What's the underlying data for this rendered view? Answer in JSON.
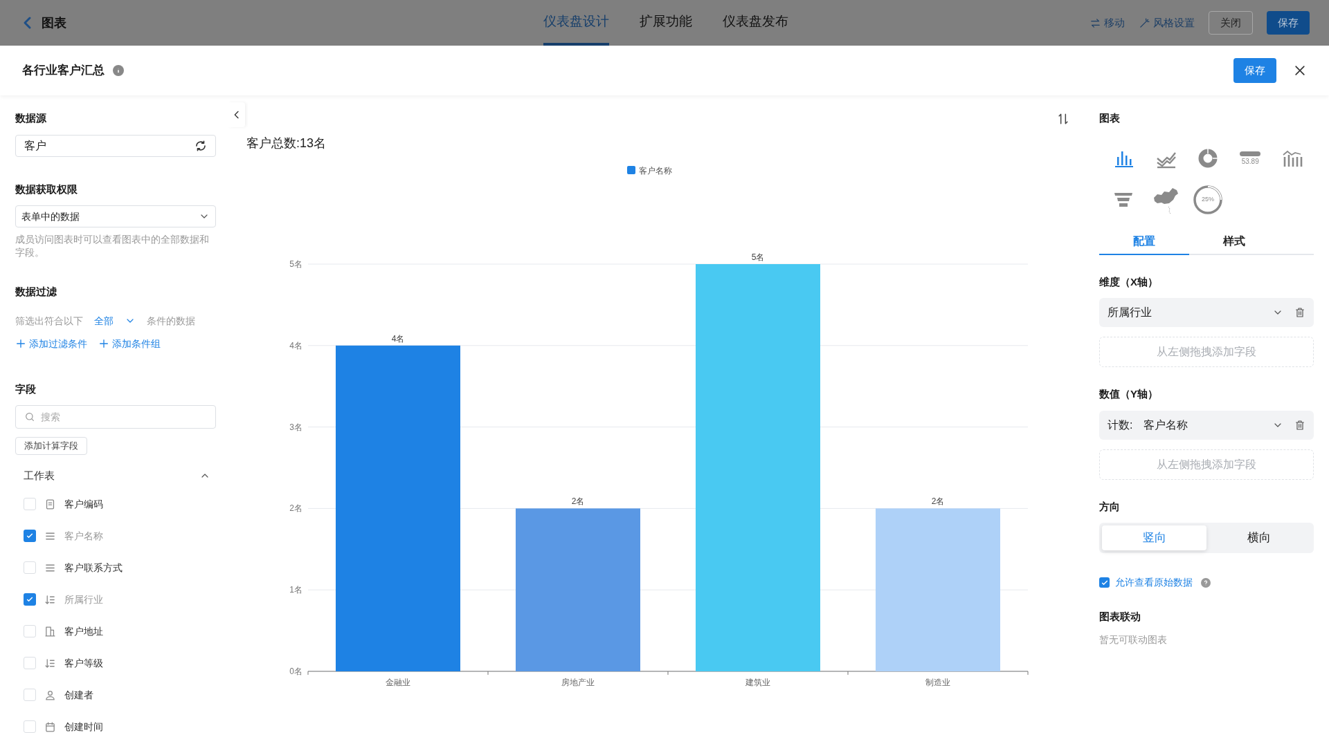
{
  "top_bar": {
    "back_label": "图表",
    "tabs": [
      {
        "label": "仪表盘设计",
        "selected": true
      },
      {
        "label": "扩展功能",
        "selected": false
      },
      {
        "label": "仪表盘发布",
        "selected": false
      }
    ],
    "actions": [
      {
        "kind": "move",
        "label": "移动"
      },
      {
        "kind": "style",
        "label": "风格设置"
      }
    ],
    "close_button": "关闭",
    "save_button": "保存"
  },
  "modal": {
    "title": "各行业客户汇总",
    "save_button": "保存"
  },
  "left_panel": {
    "datasource": {
      "title": "数据源",
      "value": "客户"
    },
    "permission": {
      "title": "数据获取权限",
      "value": "表单中的数据",
      "help": "成员访问图表时可以查看图表中的全部数据和字段。"
    },
    "filter": {
      "title": "数据过滤",
      "prefix": "筛选出符合以下",
      "mode": "全部",
      "suffix": "条件的数据",
      "add_condition": "添加过滤条件",
      "add_group": "添加条件组"
    },
    "fields": {
      "title": "字段",
      "search_placeholder": "搜索",
      "add_calc": "添加计算字段",
      "group": {
        "label": "工作表",
        "expanded": true
      },
      "items": [
        {
          "label": "客户编码",
          "kind": "serial",
          "checked": false
        },
        {
          "label": "客户名称",
          "kind": "text",
          "checked": true
        },
        {
          "label": "客户联系方式",
          "kind": "text",
          "checked": false
        },
        {
          "label": "所属行业",
          "kind": "select",
          "checked": true
        },
        {
          "label": "客户地址",
          "kind": "address",
          "checked": false
        },
        {
          "label": "客户等级",
          "kind": "select",
          "checked": false
        },
        {
          "label": "创建者",
          "kind": "user",
          "checked": false
        },
        {
          "label": "创建时间",
          "kind": "date",
          "checked": false
        }
      ]
    }
  },
  "chart": {
    "summary": "客户总数:13名",
    "chart_data": {
      "type": "bar",
      "categories": [
        "金融业",
        "房地产业",
        "建筑业",
        "制造业"
      ],
      "series": [
        {
          "name": "客户名称",
          "color": "#1e82e4",
          "colors": [
            "#1e82e4",
            "#5a98e4",
            "#49c9f2",
            "#aed1f8"
          ],
          "values": [
            4,
            2,
            5,
            2
          ]
        }
      ],
      "grid": true,
      "ylim": [
        0,
        5
      ],
      "yticks": [
        {
          "value": 0,
          "label": "0名"
        },
        {
          "value": 1,
          "label": "1名"
        },
        {
          "value": 2,
          "label": "2名"
        },
        {
          "value": 3,
          "label": "3名"
        },
        {
          "value": 4,
          "label": "4名"
        },
        {
          "value": 5,
          "label": "5名"
        }
      ],
      "value_labels": [
        "4名",
        "2名",
        "5名",
        "2名"
      ]
    }
  },
  "right_panel": {
    "chart_title": "图表",
    "chart_types": [
      {
        "kind": "bar",
        "selected": true
      },
      {
        "kind": "line",
        "selected": false
      },
      {
        "kind": "donut",
        "selected": false
      },
      {
        "kind": "indicator",
        "label": "53.89",
        "selected": false
      },
      {
        "kind": "combo",
        "selected": false
      },
      {
        "kind": "funnel",
        "selected": false
      },
      {
        "kind": "map",
        "selected": false
      },
      {
        "kind": "gauge",
        "label": "25%",
        "selected": false
      }
    ],
    "tabs": [
      {
        "label": "配置",
        "selected": true
      },
      {
        "label": "样式",
        "selected": false
      }
    ],
    "dimension": {
      "title": "维度（X轴）",
      "value": "所属行业",
      "drop_hint": "从左侧拖拽添加字段"
    },
    "measure": {
      "title": "数值（Y轴）",
      "prefix": "计数:",
      "value": "客户名称",
      "drop_hint": "从左侧拖拽添加字段"
    },
    "direction": {
      "title": "方向",
      "options": [
        {
          "label": "竖向",
          "selected": true
        },
        {
          "label": "横向",
          "selected": false
        }
      ]
    },
    "raw_data": {
      "label": "允许查看原始数据",
      "checked": true
    },
    "linkage": {
      "title": "图表联动",
      "empty": "暂无可联动图表"
    }
  }
}
